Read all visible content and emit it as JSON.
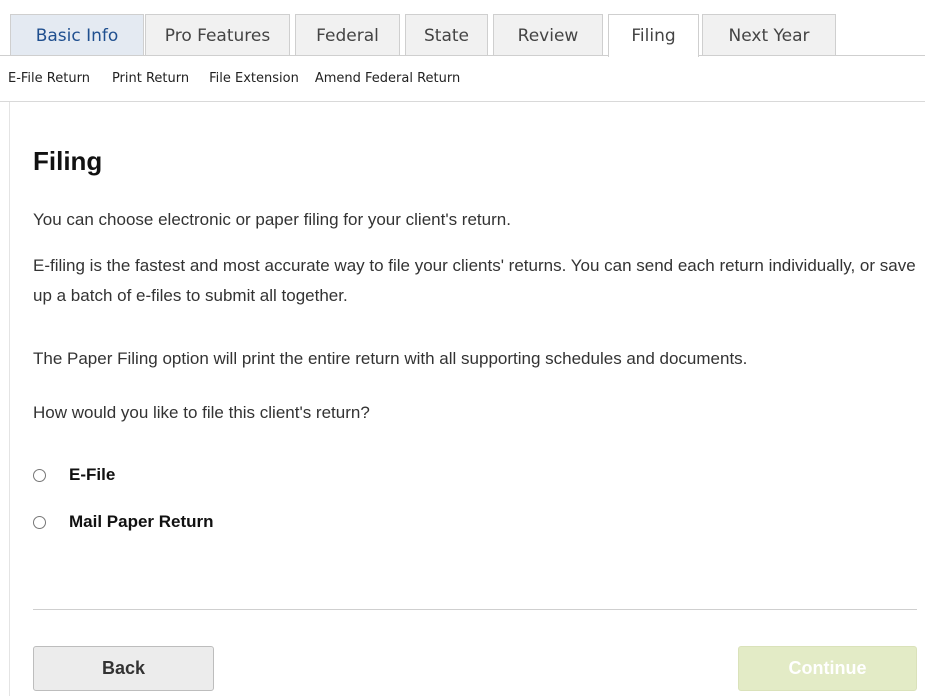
{
  "tabs": [
    {
      "label": "Basic Info"
    },
    {
      "label": "Pro Features"
    },
    {
      "label": "Federal"
    },
    {
      "label": "State"
    },
    {
      "label": "Review"
    },
    {
      "label": "Filing"
    },
    {
      "label": "Next Year"
    }
  ],
  "active_tab": "Filing",
  "subnav": {
    "items": [
      "E-File Return",
      "Print Return",
      "File Extension",
      "Amend Federal Return"
    ]
  },
  "page": {
    "title": "Filing",
    "p1": "You can choose electronic or paper filing for your client's return.",
    "p2": "E-filing is the fastest and most accurate way to file your clients' returns. You can send each return individually, or save up a batch of e-files to submit all together.",
    "p3": "The Paper Filing option will print the entire return with all supporting schedules and documents.",
    "question": "How would you like to file this client's return?",
    "options": [
      {
        "label": "E-File",
        "selected": false
      },
      {
        "label": "Mail Paper Return",
        "selected": false
      }
    ]
  },
  "buttons": {
    "back": "Back",
    "continue": "Continue",
    "continue_enabled": false
  },
  "colors": {
    "active_tab_text": "#1f4f8f",
    "continue_disabled_bg": "#e3ebc6"
  }
}
